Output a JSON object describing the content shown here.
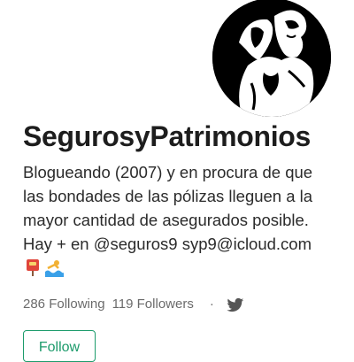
{
  "profile": {
    "name": "SegurosyPatrimonios",
    "bio_lines": [
      "Blogueando (2007) y en procura de que",
      "las bondades de las pólizas lleguen a la",
      "mayor cantidad de asegurados posible.",
      "Hay + en @seguros9 syp9@icloud.com"
    ],
    "bio_emoji": [
      "postbox-icon",
      "swimmer-icon"
    ]
  },
  "stats": {
    "following": "286 Following",
    "followers": "119 Followers",
    "separator": "·",
    "social_icon": "twitter-bird-icon"
  },
  "actions": {
    "follow_label": "Follow"
  },
  "colors": {
    "accent": "#1c9b6b",
    "muted_text": "#6b6b6b",
    "body_text": "#2b2b2b",
    "avatar_bg": "#000000"
  }
}
